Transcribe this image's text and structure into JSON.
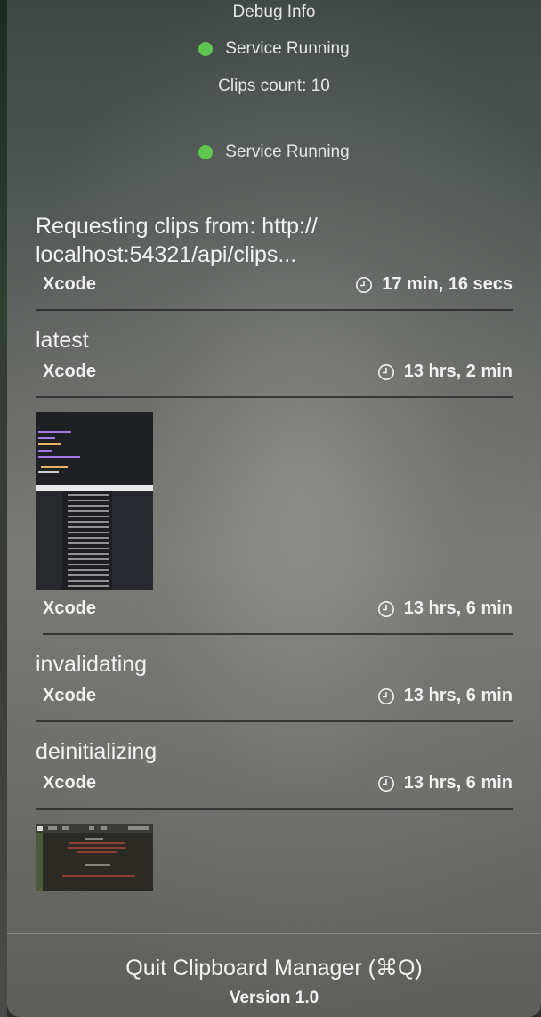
{
  "debug": {
    "title": "Debug Info",
    "status": "Service Running",
    "clips_count": "Clips count: 10",
    "status_2": "Service Running"
  },
  "colors": {
    "status_green": "#5fc64f"
  },
  "clips": [
    {
      "title": "Requesting clips from: http://\nlocalhost:54321/api/clips...",
      "app": "Xcode",
      "age": "17 min, 16 secs"
    },
    {
      "title": "latest",
      "app": "Xcode",
      "age": "13 hrs, 2 min"
    },
    {
      "title": "",
      "app": "Xcode",
      "age": "13 hrs, 6 min",
      "kind": "image"
    },
    {
      "title": "invalidating",
      "app": "Xcode",
      "age": "13 hrs, 6 min"
    },
    {
      "title": "deinitializing",
      "app": "Xcode",
      "age": "13 hrs, 6 min"
    }
  ],
  "footer": {
    "quit_label": "Quit Clipboard Manager (⌘Q)",
    "version": "Version 1.0"
  }
}
